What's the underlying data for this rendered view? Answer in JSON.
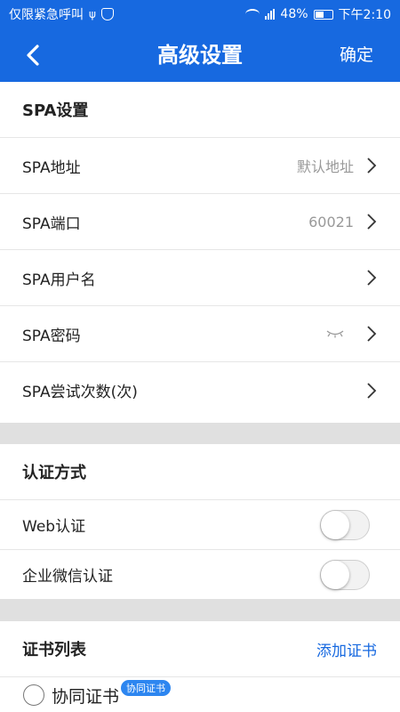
{
  "status_bar": {
    "left_text": "仅限紧急呼叫",
    "usb_symbol": "ψ",
    "battery": "48%",
    "time": "下午2:10"
  },
  "header": {
    "title": "高级设置",
    "confirm": "确定"
  },
  "spa": {
    "section_title": "SPA设置",
    "rows": [
      {
        "label": "SPA地址",
        "value": "默认地址"
      },
      {
        "label": "SPA端口",
        "value": "60021"
      },
      {
        "label": "SPA用户名",
        "value": ""
      },
      {
        "label": "SPA密码",
        "value": ""
      },
      {
        "label": "SPA尝试次数(次)",
        "value": ""
      }
    ]
  },
  "auth": {
    "section_title": "认证方式",
    "web": {
      "label": "Web认证",
      "enabled": false
    },
    "wechat": {
      "label": "企业微信认证",
      "enabled": false
    }
  },
  "certs": {
    "section_title": "证书列表",
    "add_button": "添加证书",
    "items": [
      {
        "name": "协同证书",
        "badge": "协同证书"
      }
    ]
  },
  "icons": {
    "back": "chevron-left-icon",
    "row_arrow": "chevron-right-icon",
    "password_hidden": "eye-closed-icon",
    "shield": "shield-icon",
    "wifi": "wifi-icon",
    "signal": "signal-icon",
    "battery": "battery-icon"
  },
  "colors": {
    "brand": "#1769e0",
    "link": "#1769e0",
    "badge": "#2d86f0",
    "divider_gap": "#e0e0e0"
  }
}
